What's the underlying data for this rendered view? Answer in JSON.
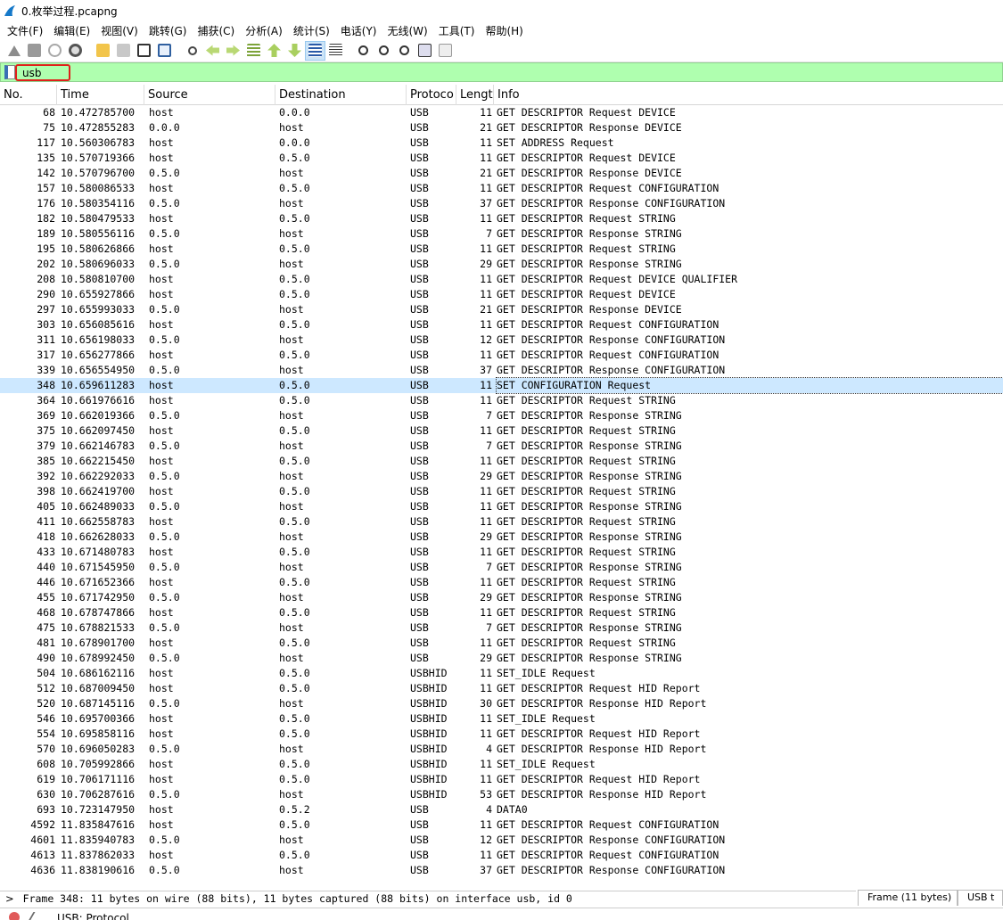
{
  "window": {
    "title": "0.枚举过程.pcapng"
  },
  "menu": [
    "文件(F)",
    "编辑(E)",
    "视图(V)",
    "跳转(G)",
    "捕获(C)",
    "分析(A)",
    "统计(S)",
    "电话(Y)",
    "无线(W)",
    "工具(T)",
    "帮助(H)"
  ],
  "toolbar_icons": [
    "start-capture-icon",
    "stop-capture-icon",
    "restart-capture-icon",
    "capture-options-icon",
    "open-file-icon",
    "save-file-icon",
    "close-file-icon",
    "reload-icon",
    "find-packet-icon",
    "go-back-icon",
    "go-forward-icon",
    "go-to-packet-icon",
    "first-packet-icon",
    "last-packet-icon",
    "autoscroll-icon",
    "colorize-icon",
    "zoom-in-icon",
    "zoom-out-icon",
    "normal-size-icon",
    "resize-columns-icon",
    "layout-icon"
  ],
  "filter": {
    "value": "usb"
  },
  "columns": [
    "No.",
    "Time",
    "Source",
    "Destination",
    "Protoco",
    "Lengt",
    "Info"
  ],
  "selected_no": "348",
  "packets": [
    [
      "68",
      "10.472785700",
      "host",
      "0.0.0",
      "USB",
      "11",
      "GET DESCRIPTOR Request DEVICE"
    ],
    [
      "75",
      "10.472855283",
      "0.0.0",
      "host",
      "USB",
      "21",
      "GET DESCRIPTOR Response DEVICE"
    ],
    [
      "117",
      "10.560306783",
      "host",
      "0.0.0",
      "USB",
      "11",
      "SET ADDRESS Request"
    ],
    [
      "135",
      "10.570719366",
      "host",
      "0.5.0",
      "USB",
      "11",
      "GET DESCRIPTOR Request DEVICE"
    ],
    [
      "142",
      "10.570796700",
      "0.5.0",
      "host",
      "USB",
      "21",
      "GET DESCRIPTOR Response DEVICE"
    ],
    [
      "157",
      "10.580086533",
      "host",
      "0.5.0",
      "USB",
      "11",
      "GET DESCRIPTOR Request CONFIGURATION"
    ],
    [
      "176",
      "10.580354116",
      "0.5.0",
      "host",
      "USB",
      "37",
      "GET DESCRIPTOR Response CONFIGURATION"
    ],
    [
      "182",
      "10.580479533",
      "host",
      "0.5.0",
      "USB",
      "11",
      "GET DESCRIPTOR Request STRING"
    ],
    [
      "189",
      "10.580556116",
      "0.5.0",
      "host",
      "USB",
      "7",
      "GET DESCRIPTOR Response STRING"
    ],
    [
      "195",
      "10.580626866",
      "host",
      "0.5.0",
      "USB",
      "11",
      "GET DESCRIPTOR Request STRING"
    ],
    [
      "202",
      "10.580696033",
      "0.5.0",
      "host",
      "USB",
      "29",
      "GET DESCRIPTOR Response STRING"
    ],
    [
      "208",
      "10.580810700",
      "host",
      "0.5.0",
      "USB",
      "11",
      "GET DESCRIPTOR Request DEVICE QUALIFIER"
    ],
    [
      "290",
      "10.655927866",
      "host",
      "0.5.0",
      "USB",
      "11",
      "GET DESCRIPTOR Request DEVICE"
    ],
    [
      "297",
      "10.655993033",
      "0.5.0",
      "host",
      "USB",
      "21",
      "GET DESCRIPTOR Response DEVICE"
    ],
    [
      "303",
      "10.656085616",
      "host",
      "0.5.0",
      "USB",
      "11",
      "GET DESCRIPTOR Request CONFIGURATION"
    ],
    [
      "311",
      "10.656198033",
      "0.5.0",
      "host",
      "USB",
      "12",
      "GET DESCRIPTOR Response CONFIGURATION"
    ],
    [
      "317",
      "10.656277866",
      "host",
      "0.5.0",
      "USB",
      "11",
      "GET DESCRIPTOR Request CONFIGURATION"
    ],
    [
      "339",
      "10.656554950",
      "0.5.0",
      "host",
      "USB",
      "37",
      "GET DESCRIPTOR Response CONFIGURATION"
    ],
    [
      "348",
      "10.659611283",
      "host",
      "0.5.0",
      "USB",
      "11",
      "SET CONFIGURATION Request"
    ],
    [
      "364",
      "10.661976616",
      "host",
      "0.5.0",
      "USB",
      "11",
      "GET DESCRIPTOR Request STRING"
    ],
    [
      "369",
      "10.662019366",
      "0.5.0",
      "host",
      "USB",
      "7",
      "GET DESCRIPTOR Response STRING"
    ],
    [
      "375",
      "10.662097450",
      "host",
      "0.5.0",
      "USB",
      "11",
      "GET DESCRIPTOR Request STRING"
    ],
    [
      "379",
      "10.662146783",
      "0.5.0",
      "host",
      "USB",
      "7",
      "GET DESCRIPTOR Response STRING"
    ],
    [
      "385",
      "10.662215450",
      "host",
      "0.5.0",
      "USB",
      "11",
      "GET DESCRIPTOR Request STRING"
    ],
    [
      "392",
      "10.662292033",
      "0.5.0",
      "host",
      "USB",
      "29",
      "GET DESCRIPTOR Response STRING"
    ],
    [
      "398",
      "10.662419700",
      "host",
      "0.5.0",
      "USB",
      "11",
      "GET DESCRIPTOR Request STRING"
    ],
    [
      "405",
      "10.662489033",
      "0.5.0",
      "host",
      "USB",
      "11",
      "GET DESCRIPTOR Response STRING"
    ],
    [
      "411",
      "10.662558783",
      "host",
      "0.5.0",
      "USB",
      "11",
      "GET DESCRIPTOR Request STRING"
    ],
    [
      "418",
      "10.662628033",
      "0.5.0",
      "host",
      "USB",
      "29",
      "GET DESCRIPTOR Response STRING"
    ],
    [
      "433",
      "10.671480783",
      "host",
      "0.5.0",
      "USB",
      "11",
      "GET DESCRIPTOR Request STRING"
    ],
    [
      "440",
      "10.671545950",
      "0.5.0",
      "host",
      "USB",
      "7",
      "GET DESCRIPTOR Response STRING"
    ],
    [
      "446",
      "10.671652366",
      "host",
      "0.5.0",
      "USB",
      "11",
      "GET DESCRIPTOR Request STRING"
    ],
    [
      "455",
      "10.671742950",
      "0.5.0",
      "host",
      "USB",
      "29",
      "GET DESCRIPTOR Response STRING"
    ],
    [
      "468",
      "10.678747866",
      "host",
      "0.5.0",
      "USB",
      "11",
      "GET DESCRIPTOR Request STRING"
    ],
    [
      "475",
      "10.678821533",
      "0.5.0",
      "host",
      "USB",
      "7",
      "GET DESCRIPTOR Response STRING"
    ],
    [
      "481",
      "10.678901700",
      "host",
      "0.5.0",
      "USB",
      "11",
      "GET DESCRIPTOR Request STRING"
    ],
    [
      "490",
      "10.678992450",
      "0.5.0",
      "host",
      "USB",
      "29",
      "GET DESCRIPTOR Response STRING"
    ],
    [
      "504",
      "10.686162116",
      "host",
      "0.5.0",
      "USBHID",
      "11",
      "SET_IDLE Request"
    ],
    [
      "512",
      "10.687009450",
      "host",
      "0.5.0",
      "USBHID",
      "11",
      "GET DESCRIPTOR Request HID Report"
    ],
    [
      "520",
      "10.687145116",
      "0.5.0",
      "host",
      "USBHID",
      "30",
      "GET DESCRIPTOR Response HID Report"
    ],
    [
      "546",
      "10.695700366",
      "host",
      "0.5.0",
      "USBHID",
      "11",
      "SET_IDLE Request"
    ],
    [
      "554",
      "10.695858116",
      "host",
      "0.5.0",
      "USBHID",
      "11",
      "GET DESCRIPTOR Request HID Report"
    ],
    [
      "570",
      "10.696050283",
      "0.5.0",
      "host",
      "USBHID",
      "4",
      "GET DESCRIPTOR Response HID Report"
    ],
    [
      "608",
      "10.705992866",
      "host",
      "0.5.0",
      "USBHID",
      "11",
      "SET_IDLE Request"
    ],
    [
      "619",
      "10.706171116",
      "host",
      "0.5.0",
      "USBHID",
      "11",
      "GET DESCRIPTOR Request HID Report"
    ],
    [
      "630",
      "10.706287616",
      "0.5.0",
      "host",
      "USBHID",
      "53",
      "GET DESCRIPTOR Response HID Report"
    ],
    [
      "693",
      "10.723147950",
      "host",
      "0.5.2",
      "USB",
      "4",
      "DATA0"
    ],
    [
      "4592",
      "11.835847616",
      "host",
      "0.5.0",
      "USB",
      "11",
      "GET DESCRIPTOR Request CONFIGURATION"
    ],
    [
      "4601",
      "11.835940783",
      "0.5.0",
      "host",
      "USB",
      "12",
      "GET DESCRIPTOR Response CONFIGURATION"
    ],
    [
      "4613",
      "11.837862033",
      "host",
      "0.5.0",
      "USB",
      "11",
      "GET DESCRIPTOR Request CONFIGURATION"
    ],
    [
      "4636",
      "11.838190616",
      "0.5.0",
      "host",
      "USB",
      "37",
      "GET DESCRIPTOR Response CONFIGURATION"
    ]
  ],
  "detail": {
    "expander": ">",
    "frame_line": "Frame 348: 11 bytes on wire (88 bits), 11 bytes captured (88 bits) on interface usb, id 0"
  },
  "byte_tabs": [
    "Frame (11 bytes)",
    "USB t"
  ],
  "statusbar": {
    "text": "USB: Protocol"
  },
  "colors": {
    "filter_bg": "#afffaf",
    "filter_highlight": "#e0201a",
    "selected_row": "#cde8ff"
  }
}
